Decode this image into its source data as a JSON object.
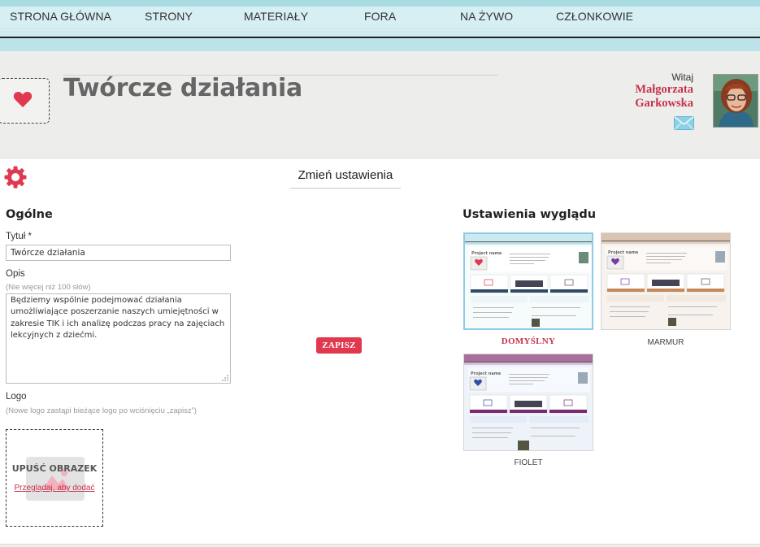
{
  "nav": {
    "items": [
      "STRONA GŁÓWNA",
      "STRONY",
      "MATERIAŁY",
      "FORA",
      "NA ŻYWO",
      "CZŁONKOWIE"
    ]
  },
  "header": {
    "title": "Twórcze działania",
    "greeting": "Witaj",
    "user_first": "Małgorzata",
    "user_last": "Garkowska",
    "logo_icon": "heart-icon",
    "mail_icon": "envelope-icon"
  },
  "settings": {
    "heading": "Zmień ustawienia",
    "icon": "gear-icon",
    "general_heading": "Ogólne",
    "title_label": "Tytuł *",
    "title_value": "Twórcze działania",
    "desc_label": "Opis",
    "desc_hint": "(Nie więcej niż 100 słów)",
    "desc_value": "Będziemy wspólnie podejmować działania umożliwiające poszerzanie naszych umiejętności w zakresie TIK i ich analizę podczas pracy na zajęciach lekcyjnych z dziećmi.",
    "logo_label": "Logo",
    "logo_hint": "(Nowe logo zastąpi bieżące logo po wciśnięciu „zapisz”)",
    "drop_title": "UPUŚĆ OBRAZEK",
    "drop_link": "Przeglądaj, aby dodać",
    "save_label": "ZAPISZ"
  },
  "appearance": {
    "heading": "Ustawienia wyglądu",
    "themes": [
      {
        "name": "DOMYŚLNY",
        "selected": true,
        "thumb_title": "Project name"
      },
      {
        "name": "MARMUR",
        "selected": false,
        "thumb_title": "Project name"
      },
      {
        "name": "FIOLET",
        "selected": false,
        "thumb_title": "Project name"
      }
    ]
  },
  "colors": {
    "accent": "#e0394f",
    "nav_bg": "#d6eff3",
    "selected_theme_border": "#8ec9e6"
  }
}
